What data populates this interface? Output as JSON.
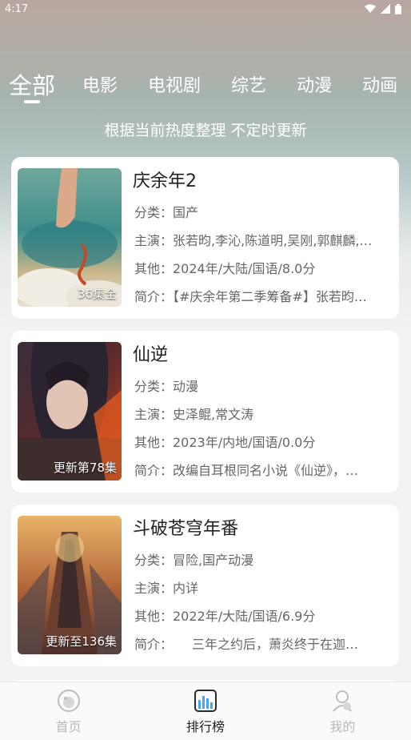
{
  "status": {
    "time": "4:17"
  },
  "tabs": [
    {
      "label": "全部"
    },
    {
      "label": "电影"
    },
    {
      "label": "电视剧"
    },
    {
      "label": "综艺"
    },
    {
      "label": "动漫"
    },
    {
      "label": "动画"
    }
  ],
  "subtitle": "根据当前热度整理 不定时更新",
  "items": [
    {
      "title": "庆余年2",
      "badge": "36集全",
      "category": "分类：国产",
      "cast": "主演：张若昀,李沁,陈道明,吴刚,郭麒麟,…",
      "other": "其他：2024年/大陆/国语/8.0分",
      "intro": "简介：【#庆余年第二季筹备#】张若昀…"
    },
    {
      "title": "仙逆",
      "badge": "更新第78集",
      "category": "分类：动漫",
      "cast": "主演：史泽鲲,常文涛",
      "other": "其他：2023年/内地/国语/0.0分",
      "intro": "简介：改编自耳根同名小说《仙逆》，…"
    },
    {
      "title": "斗破苍穹年番",
      "badge": "更新至136集",
      "category": "分类：冒险,国产动漫",
      "cast": "主演：内详",
      "other": "其他：2022年/大陆/国语/6.9分",
      "intro": "简介：　　三年之约后，萧炎终于在迦…"
    }
  ],
  "nav": [
    {
      "label": "首页",
      "icon": "home-icon"
    },
    {
      "label": "排行榜",
      "icon": "ranking-icon"
    },
    {
      "label": "我的",
      "icon": "profile-icon"
    }
  ]
}
